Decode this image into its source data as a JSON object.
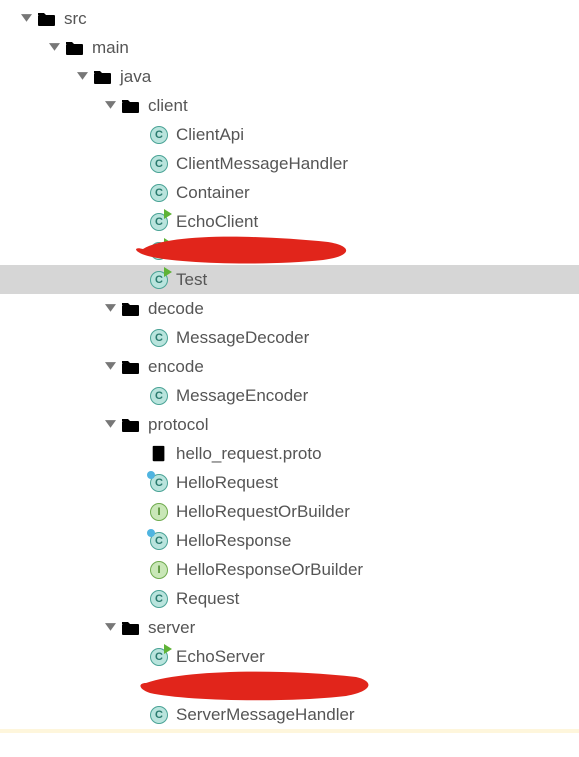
{
  "tree": {
    "root": {
      "label": "src",
      "children": {
        "main": {
          "label": "main",
          "children": {
            "java": {
              "label": "java",
              "children": {
                "client": {
                  "label": "client",
                  "files": {
                    "clientapi": "ClientApi",
                    "clientmessagehandler": "ClientMessageHandler",
                    "container": "Container",
                    "echoclient": "EchoClient",
                    "test": "Test"
                  }
                },
                "decode": {
                  "label": "decode",
                  "files": {
                    "messagedecoder": "MessageDecoder"
                  }
                },
                "encode": {
                  "label": "encode",
                  "files": {
                    "messageencoder": "MessageEncoder"
                  }
                },
                "protocol": {
                  "label": "protocol",
                  "files": {
                    "hellorequestproto": "hello_request.proto",
                    "hellorequest": "HelloRequest",
                    "hellorequestorbuilder": "HelloRequestOrBuilder",
                    "helloresponse": "HelloResponse",
                    "helloresponseorbuilder": "HelloResponseOrBuilder",
                    "request": "Request"
                  }
                },
                "server": {
                  "label": "server",
                  "files": {
                    "echoserver": "EchoServer",
                    "servermessagehandler": "ServerMessageHandler"
                  }
                }
              }
            }
          }
        }
      }
    }
  }
}
